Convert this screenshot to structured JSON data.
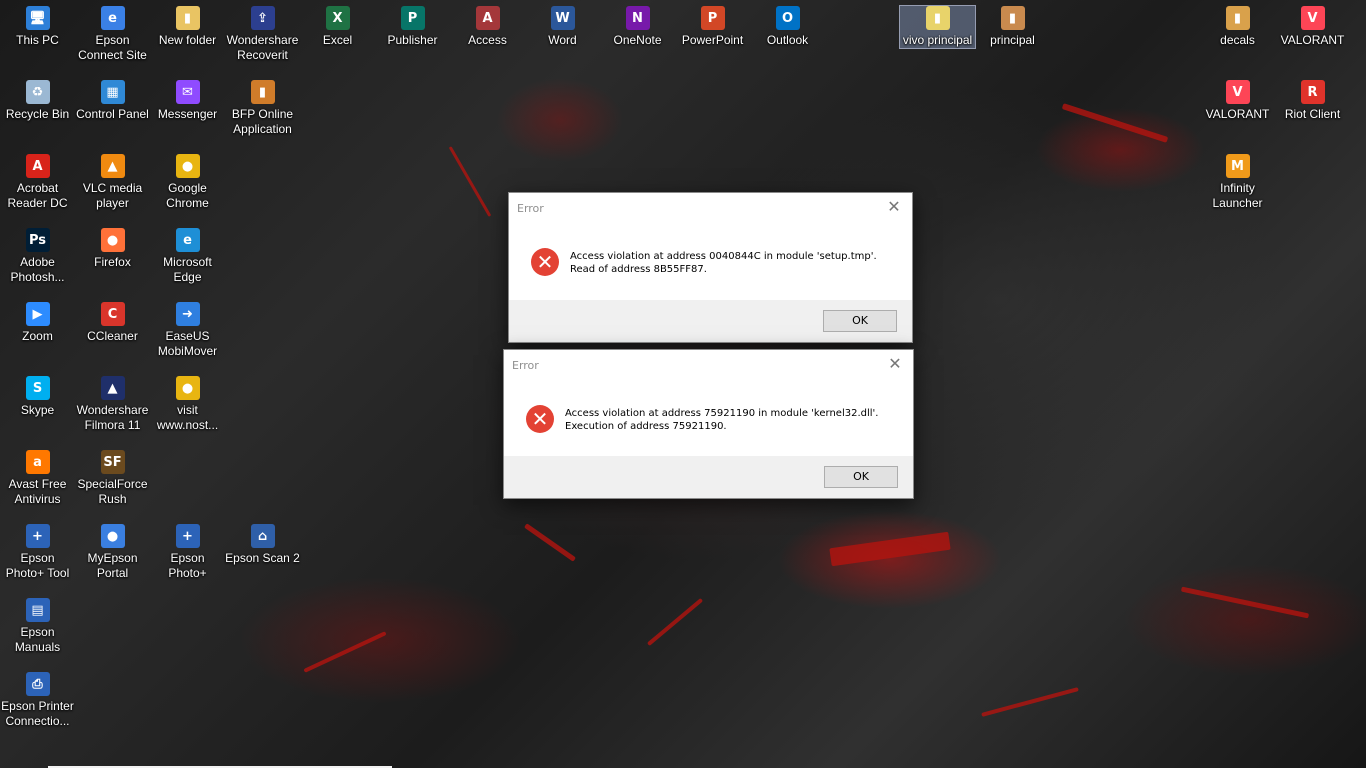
{
  "desktop_icons": [
    {
      "label": "This PC",
      "icon": "this-pc-icon",
      "color": "#2d7fd8",
      "glyph": "🖥"
    },
    {
      "label": "Epson Connect Site",
      "icon": "epson-connect-icon",
      "color": "#3a80e6",
      "glyph": "e"
    },
    {
      "label": "New folder",
      "icon": "folder-icon",
      "color": "#e9c463",
      "glyph": "▮"
    },
    {
      "label": "Wondershare Recoverit",
      "icon": "recoverit-icon",
      "color": "#2c3f8f",
      "glyph": "⇪"
    },
    {
      "label": "Excel",
      "icon": "excel-icon",
      "color": "#1f7244",
      "glyph": "X"
    },
    {
      "label": "Publisher",
      "icon": "publisher-icon",
      "color": "#077568",
      "glyph": "P"
    },
    {
      "label": "Access",
      "icon": "access-icon",
      "color": "#a4373a",
      "glyph": "A"
    },
    {
      "label": "Word",
      "icon": "word-icon",
      "color": "#2b579a",
      "glyph": "W"
    },
    {
      "label": "OneNote",
      "icon": "onenote-icon",
      "color": "#7719aa",
      "glyph": "N"
    },
    {
      "label": "PowerPoint",
      "icon": "powerpoint-icon",
      "color": "#d24726",
      "glyph": "P"
    },
    {
      "label": "Outlook",
      "icon": "outlook-icon",
      "color": "#0072c6",
      "glyph": "O"
    },
    {
      "label": "vivo principal",
      "icon": "file-icon",
      "color": "#e8d36a",
      "glyph": "▮"
    },
    {
      "label": "principal",
      "icon": "file-icon",
      "color": "#c98a4e",
      "glyph": "▮"
    },
    {
      "label": "decals",
      "icon": "folder-icon",
      "color": "#d9a14b",
      "glyph": "▮"
    },
    {
      "label": "VALORANT",
      "icon": "valorant-icon",
      "color": "#fd4556",
      "glyph": "V"
    },
    {
      "label": "Recycle Bin",
      "icon": "recycle-bin-icon",
      "color": "#9bb8d3",
      "glyph": "♻"
    },
    {
      "label": "Control Panel",
      "icon": "control-panel-icon",
      "color": "#2f89d6",
      "glyph": "▦"
    },
    {
      "label": "Messenger",
      "icon": "messenger-icon",
      "color": "#8f4bff",
      "glyph": "✉"
    },
    {
      "label": "BFP Online Application",
      "icon": "bfp-icon",
      "color": "#d07c2a",
      "glyph": "▮"
    },
    {
      "label": "VALORANT",
      "icon": "valorant-icon",
      "color": "#fd4556",
      "glyph": "V"
    },
    {
      "label": "Riot Client",
      "icon": "riot-client-icon",
      "color": "#e0332b",
      "glyph": "R"
    },
    {
      "label": "Acrobat Reader DC",
      "icon": "acrobat-icon",
      "color": "#d8231a",
      "glyph": "A"
    },
    {
      "label": "VLC media player",
      "icon": "vlc-icon",
      "color": "#f08a10",
      "glyph": "▲"
    },
    {
      "label": "Google Chrome",
      "icon": "chrome-icon",
      "color": "#e8b511",
      "glyph": "●"
    },
    {
      "label": "Infinity Launcher",
      "icon": "infinity-launcher-icon",
      "color": "#f09a1a",
      "glyph": "M"
    },
    {
      "label": "Adobe Photosh...",
      "icon": "photoshop-icon",
      "color": "#001e36",
      "glyph": "Ps"
    },
    {
      "label": "Firefox",
      "icon": "firefox-icon",
      "color": "#ff7139",
      "glyph": "●"
    },
    {
      "label": "Microsoft Edge",
      "icon": "edge-icon",
      "color": "#1e8fd6",
      "glyph": "e"
    },
    {
      "label": "Zoom",
      "icon": "zoom-icon",
      "color": "#2d8cff",
      "glyph": "▶"
    },
    {
      "label": "CCleaner",
      "icon": "ccleaner-icon",
      "color": "#d9352b",
      "glyph": "C"
    },
    {
      "label": "EaseUS MobiMover",
      "icon": "mobimover-icon",
      "color": "#2f7fe0",
      "glyph": "➜"
    },
    {
      "label": "Skype",
      "icon": "skype-icon",
      "color": "#00aff0",
      "glyph": "S"
    },
    {
      "label": "Wondershare Filmora 11",
      "icon": "filmora-icon",
      "color": "#1f2f6a",
      "glyph": "▲"
    },
    {
      "label": "visit www.nost...",
      "icon": "chrome-icon",
      "color": "#e8b511",
      "glyph": "●"
    },
    {
      "label": "Avast Free Antivirus",
      "icon": "avast-icon",
      "color": "#ff7800",
      "glyph": "a"
    },
    {
      "label": "SpecialForce Rush",
      "icon": "specialforce-icon",
      "color": "#6b4a1e",
      "glyph": "SF"
    },
    {
      "label": "Epson Photo+ Tool",
      "icon": "epson-photo-tool-icon",
      "color": "#2c63b8",
      "glyph": "+"
    },
    {
      "label": "MyEpson Portal",
      "icon": "myepson-icon",
      "color": "#3a7fe0",
      "glyph": "●"
    },
    {
      "label": "Epson Photo+",
      "icon": "epson-photo-icon",
      "color": "#2c63b8",
      "glyph": "+"
    },
    {
      "label": "Epson Scan 2",
      "icon": "epson-scan-icon",
      "color": "#2f5fa8",
      "glyph": "⌂"
    },
    {
      "label": "Epson Manuals",
      "icon": "epson-manuals-icon",
      "color": "#2c63b8",
      "glyph": "▤"
    },
    {
      "label": "Epson Printer Connectio...",
      "icon": "epson-printer-icon",
      "color": "#2c63b8",
      "glyph": "⎙"
    }
  ],
  "dialogs": [
    {
      "title": "Error",
      "close_glyph": "✕",
      "icon": "error-icon",
      "icon_glyph": "✕",
      "line1": "Access violation at address 0040844C in module 'setup.tmp'.",
      "line2": "Read of address 8B55FF87.",
      "ok_label": "OK"
    },
    {
      "title": "Error",
      "close_glyph": "✕",
      "icon": "error-icon",
      "icon_glyph": "✕",
      "line1": "Access violation at address 75921190 in module 'kernel32.dll'.",
      "line2": "Execution of address 75921190.",
      "ok_label": "OK"
    }
  ],
  "colors": {
    "error_red": "#e34234",
    "lava_red": "#b3140f",
    "dialog_footer": "#f0f0f0"
  }
}
